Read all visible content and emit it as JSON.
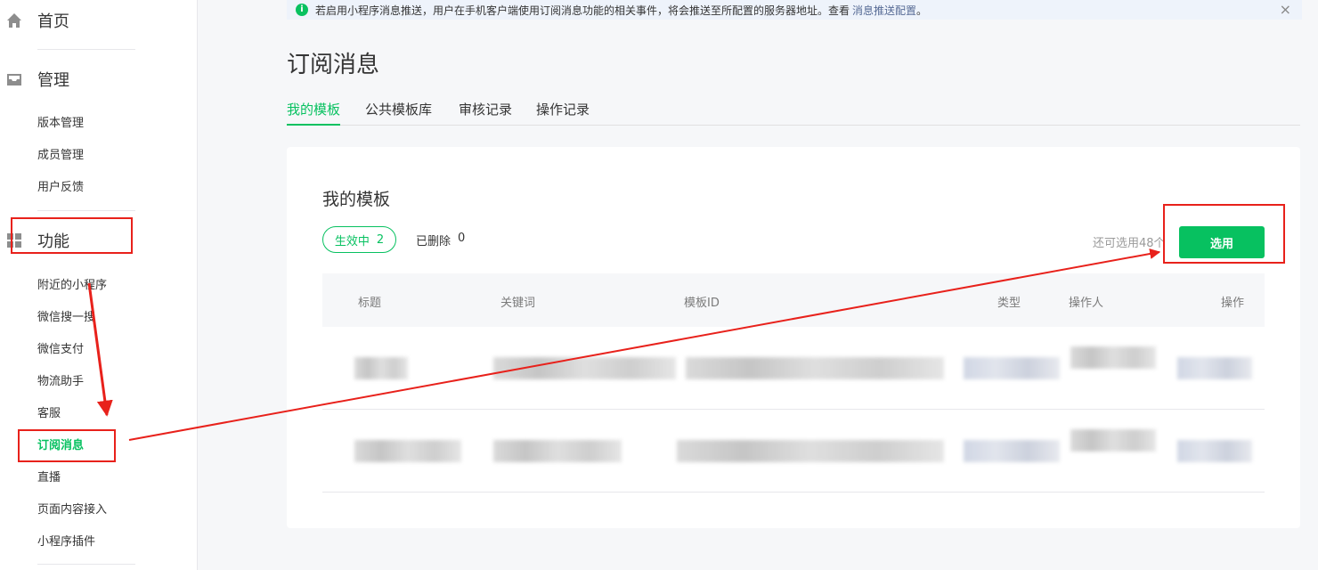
{
  "sidebar": {
    "home_label": "首页",
    "manage_label": "管理",
    "manage_items": [
      "版本管理",
      "成员管理",
      "用户反馈"
    ],
    "feature_label": "功能",
    "feature_items": [
      "附近的小程序",
      "微信搜一搜",
      "微信支付",
      "物流助手",
      "客服",
      "订阅消息",
      "直播",
      "页面内容接入",
      "小程序插件"
    ]
  },
  "notice": {
    "text": "若启用小程序消息推送，用户在手机客户端使用订阅消息功能的相关事件，将会推送至所配置的服务器地址。查看",
    "link": "消息推送配置",
    "suffix": "。",
    "close": "×"
  },
  "page_title": "订阅消息",
  "tabs": [
    "我的模板",
    "公共模板库",
    "审核记录",
    "操作记录"
  ],
  "card": {
    "title": "我的模板",
    "active_status": {
      "label": "生效中",
      "count": "2"
    },
    "deleted_status": {
      "label": "已删除",
      "count": "0"
    },
    "remaining": "还可选用48个",
    "select_button": "选用"
  },
  "table": {
    "headers": [
      "标题",
      "关键词",
      "模板ID",
      "类型",
      "操作人",
      "操作"
    ]
  },
  "colors": {
    "accent": "#07c160",
    "annotation": "#e8211b",
    "link": "#576b95"
  },
  "icons": [
    "home-icon",
    "inbox-icon",
    "grid-icon",
    "info-icon",
    "close-icon"
  ]
}
